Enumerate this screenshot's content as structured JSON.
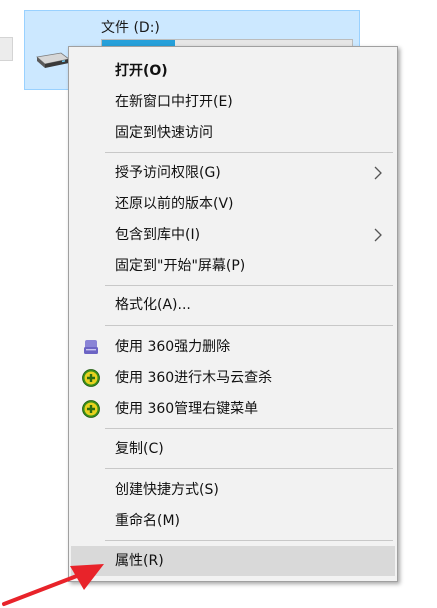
{
  "drive": {
    "name": "文件 (D:)",
    "usage_fraction": 0.29,
    "bar_fill_color": "#26a0da",
    "icon": "hard-drive-icon"
  },
  "context_menu": {
    "items": [
      {
        "label": "打开(O)",
        "bold": true
      },
      {
        "label": "在新窗口中打开(E)"
      },
      {
        "label": "固定到快速访问"
      },
      {
        "label": "授予访问权限(G)",
        "submenu": true
      },
      {
        "label": "还原以前的版本(V)"
      },
      {
        "label": "包含到库中(I)",
        "submenu": true
      },
      {
        "label": "固定到\"开始\"屏幕(P)"
      },
      {
        "label": "格式化(A)..."
      },
      {
        "label": "使用 360强力删除",
        "icon": "360-shred-icon"
      },
      {
        "label": "使用 360进行木马云查杀",
        "icon": "360-scan-icon"
      },
      {
        "label": "使用 360管理右键菜单",
        "icon": "360-manage-icon"
      },
      {
        "label": "复制(C)"
      },
      {
        "label": "创建快捷方式(S)"
      },
      {
        "label": "重命名(M)"
      },
      {
        "label": "属性(R)",
        "highlighted": true
      }
    ]
  },
  "colors": {
    "menu_bg": "#f2f2f2",
    "highlight_bg": "#d9d9d9",
    "selection_bg": "#cce8ff",
    "arrow": "#e8232a"
  }
}
